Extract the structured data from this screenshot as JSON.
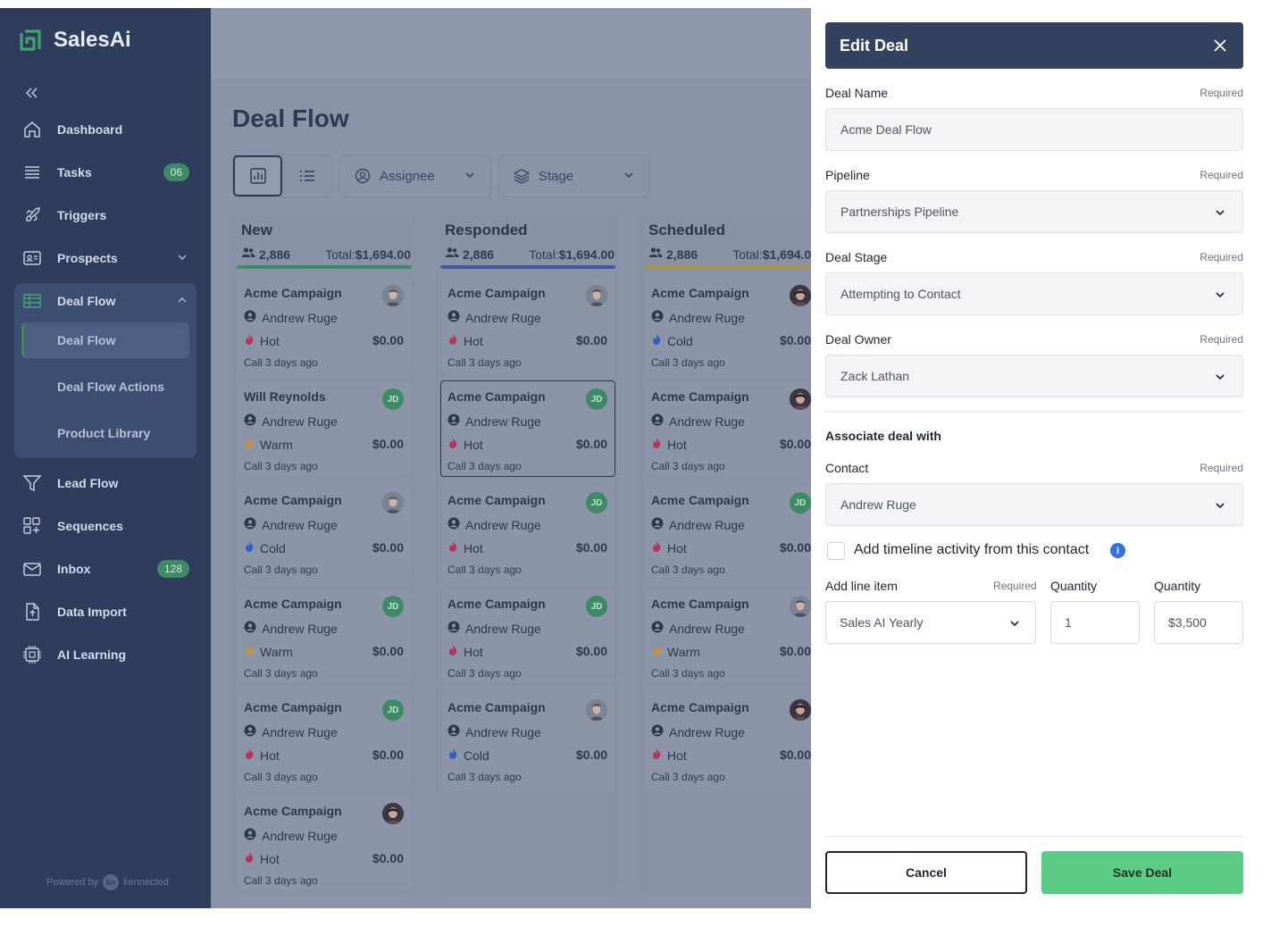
{
  "app": {
    "name": "SalesAi",
    "powered_by": "Powered by",
    "powered_brand": "kennected",
    "powered_logo": "kn"
  },
  "sidebar": {
    "items": [
      {
        "label": "Dashboard",
        "icon": "home-icon"
      },
      {
        "label": "Tasks",
        "icon": "list-icon",
        "badge": "06"
      },
      {
        "label": "Triggers",
        "icon": "rocket-icon"
      },
      {
        "label": "Prospects",
        "icon": "id-card-icon"
      },
      {
        "label": "Deal Flow",
        "icon": "table-icon"
      },
      {
        "label": "Lead Flow",
        "icon": "funnel-icon"
      },
      {
        "label": "Sequences",
        "icon": "grid-plus-icon"
      },
      {
        "label": "Inbox",
        "icon": "mail-icon",
        "badge": "128"
      },
      {
        "label": "Data Import",
        "icon": "file-upload-icon"
      },
      {
        "label": "AI Learning",
        "icon": "chip-icon"
      }
    ],
    "deal_flow_sub": [
      "Deal Flow",
      "Deal Flow Actions",
      "Product Library"
    ]
  },
  "main": {
    "title": "Deal Flow",
    "filters": {
      "assignee": "Assignee",
      "stage": "Stage"
    },
    "columns": [
      {
        "title": "New",
        "count": "2,886",
        "total_label": "Total:",
        "total": "$1,694.00",
        "color": "#3e8a67",
        "cards": [
          {
            "title": "Acme Campaign",
            "person": "Andrew Ruge",
            "temp": "Hot",
            "amount": "$0.00",
            "call": "Call 3 days ago",
            "avatar": "photo-m"
          },
          {
            "title": "Will Reynolds",
            "person": "Andrew Ruge",
            "temp": "Warm",
            "amount": "$0.00",
            "call": "Call 3 days ago",
            "avatar": "JD"
          },
          {
            "title": "Acme Campaign",
            "person": "Andrew Ruge",
            "temp": "Cold",
            "amount": "$0.00",
            "call": "Call 3 days ago",
            "avatar": "photo-m"
          },
          {
            "title": "Acme Campaign",
            "person": "Andrew Ruge",
            "temp": "Warm",
            "amount": "$0.00",
            "call": "Call 3 days ago",
            "avatar": "JD"
          },
          {
            "title": "Acme Campaign",
            "person": "Andrew Ruge",
            "temp": "Hot",
            "amount": "$0.00",
            "call": "Call 3 days ago",
            "avatar": "JD"
          },
          {
            "title": "Acme Campaign",
            "person": "Andrew Ruge",
            "temp": "Hot",
            "amount": "$0.00",
            "call": "Call 3 days ago",
            "avatar": "photo-f"
          }
        ]
      },
      {
        "title": "Responded",
        "count": "2,886",
        "total_label": "Total:",
        "total": "$1,694.00",
        "color": "#3f5c9e",
        "cards": [
          {
            "title": "Acme Campaign",
            "person": "Andrew Ruge",
            "temp": "Hot",
            "amount": "$0.00",
            "call": "Call 3 days ago",
            "avatar": "photo-m"
          },
          {
            "title": "Acme Campaign",
            "person": "Andrew Ruge",
            "temp": "Hot",
            "amount": "$0.00",
            "call": "Call 3 days ago",
            "avatar": "JD",
            "selected": true
          },
          {
            "title": "Acme Campaign",
            "person": "Andrew Ruge",
            "temp": "Hot",
            "amount": "$0.00",
            "call": "Call 3 days ago",
            "avatar": "JD"
          },
          {
            "title": "Acme Campaign",
            "person": "Andrew Ruge",
            "temp": "Hot",
            "amount": "$0.00",
            "call": "Call 3 days ago",
            "avatar": "JD"
          },
          {
            "title": "Acme Campaign",
            "person": "Andrew Ruge",
            "temp": "Cold",
            "amount": "$0.00",
            "call": "Call 3 days ago",
            "avatar": "photo-m"
          }
        ]
      },
      {
        "title": "Scheduled",
        "count": "2,886",
        "total_label": "Total:",
        "total": "$1,694.00",
        "color": "#a8944a",
        "cards": [
          {
            "title": "Acme Campaign",
            "person": "Andrew Ruge",
            "temp": "Cold",
            "amount": "$0.00",
            "call": "Call 3 days ago",
            "avatar": "photo-f"
          },
          {
            "title": "Acme Campaign",
            "person": "Andrew Ruge",
            "temp": "Hot",
            "amount": "$0.00",
            "call": "Call 3 days ago",
            "avatar": "photo-f"
          },
          {
            "title": "Acme Campaign",
            "person": "Andrew Ruge",
            "temp": "Hot",
            "amount": "$0.00",
            "call": "Call 3 days ago",
            "avatar": "JD"
          },
          {
            "title": "Acme Campaign",
            "person": "Andrew Ruge",
            "temp": "Warm",
            "amount": "$0.00",
            "call": "Call 3 days ago",
            "avatar": "photo-m"
          },
          {
            "title": "Acme Campaign",
            "person": "Andrew Ruge",
            "temp": "Hot",
            "amount": "$0.00",
            "call": "Call 3 days ago",
            "avatar": "photo-f"
          }
        ]
      }
    ],
    "temp_colors": {
      "Hot": "#b8325a",
      "Warm": "#c9903a",
      "Cold": "#2f5fc0"
    }
  },
  "panel": {
    "title": "Edit Deal",
    "required": "Required",
    "deal_name": {
      "label": "Deal Name",
      "value": "Acme Deal Flow"
    },
    "pipeline": {
      "label": "Pipeline",
      "value": "Partnerships Pipeline"
    },
    "deal_stage": {
      "label": "Deal Stage",
      "value": "Attempting to Contact"
    },
    "deal_owner": {
      "label": "Deal Owner",
      "value": "Zack Lathan"
    },
    "associate_title": "Associate deal with",
    "contact": {
      "label": "Contact",
      "value": "Andrew Ruge"
    },
    "timeline_label": "Add timeline activity from this contact",
    "line_item": {
      "label": "Add line item",
      "value": "Sales AI Yearly"
    },
    "quantity": {
      "label": "Quantity",
      "value": "1"
    },
    "price": {
      "label": "Quantity",
      "value": "$3,500"
    },
    "cancel": "Cancel",
    "save": "Save Deal"
  }
}
